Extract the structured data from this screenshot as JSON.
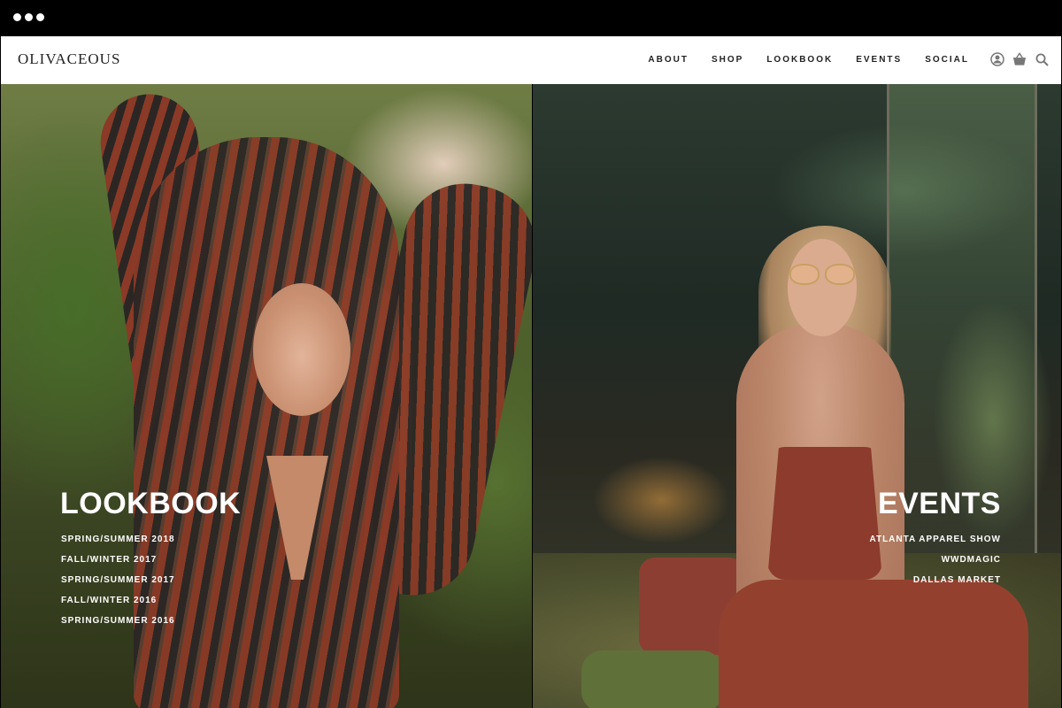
{
  "window": {
    "controls": [
      "dot",
      "dot",
      "dot"
    ]
  },
  "header": {
    "logo": "OLIVACEOUS",
    "nav": [
      "ABOUT",
      "SHOP",
      "LOOKBOOK",
      "EVENTS",
      "SOCIAL"
    ],
    "tools": [
      "user-icon",
      "basket-icon",
      "search-icon"
    ]
  },
  "lookbook": {
    "title": "LOOKBOOK",
    "items": [
      "SPRING/SUMMER 2018",
      "FALL/WINTER 2017",
      "SPRING/SUMMER 2017",
      "FALL/WINTER 2016",
      "SPRING/SUMMER 2016"
    ]
  },
  "events": {
    "title": "EVENTS",
    "items": [
      "ATLANTA APPAREL SHOW",
      "WWDMAGIC",
      "DALLAS MARKET"
    ]
  },
  "colors": {
    "accent": "#8a3a26",
    "header_bg": "#ffffff",
    "text": "#222222"
  }
}
